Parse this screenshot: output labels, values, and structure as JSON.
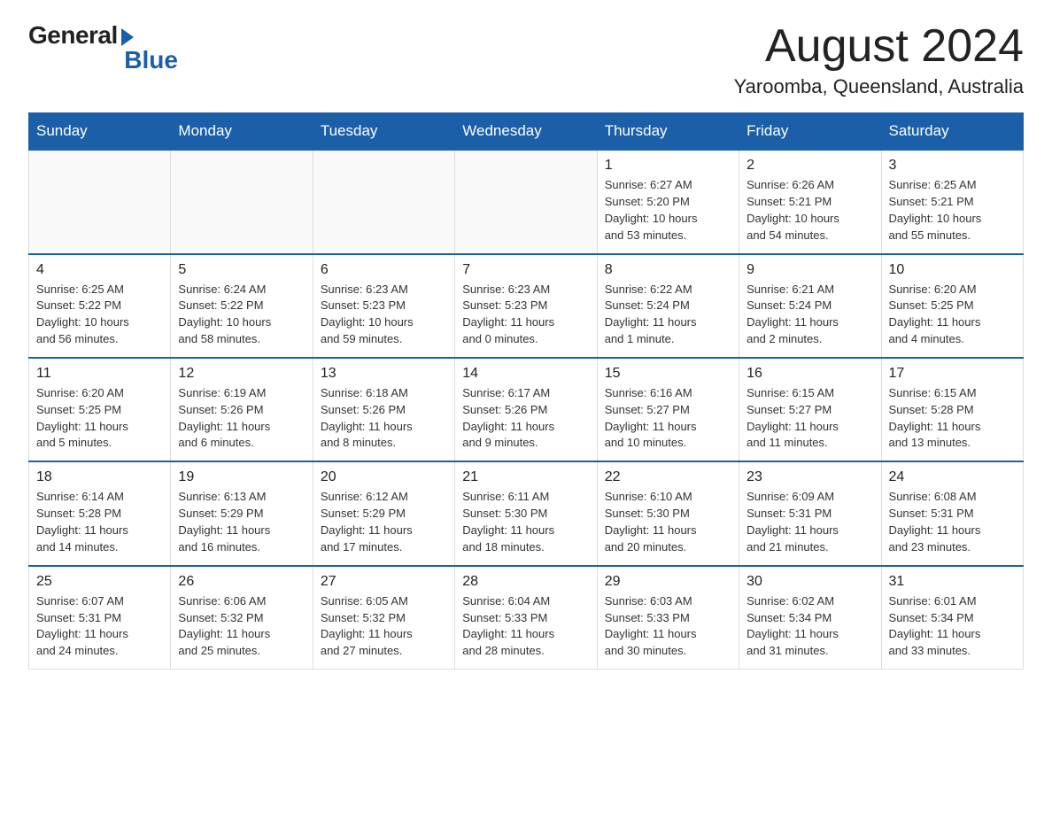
{
  "logo": {
    "general": "General",
    "blue": "Blue"
  },
  "title": "August 2024",
  "location": "Yaroomba, Queensland, Australia",
  "days_of_week": [
    "Sunday",
    "Monday",
    "Tuesday",
    "Wednesday",
    "Thursday",
    "Friday",
    "Saturday"
  ],
  "weeks": [
    [
      {
        "day": "",
        "info": ""
      },
      {
        "day": "",
        "info": ""
      },
      {
        "day": "",
        "info": ""
      },
      {
        "day": "",
        "info": ""
      },
      {
        "day": "1",
        "info": "Sunrise: 6:27 AM\nSunset: 5:20 PM\nDaylight: 10 hours\nand 53 minutes."
      },
      {
        "day": "2",
        "info": "Sunrise: 6:26 AM\nSunset: 5:21 PM\nDaylight: 10 hours\nand 54 minutes."
      },
      {
        "day": "3",
        "info": "Sunrise: 6:25 AM\nSunset: 5:21 PM\nDaylight: 10 hours\nand 55 minutes."
      }
    ],
    [
      {
        "day": "4",
        "info": "Sunrise: 6:25 AM\nSunset: 5:22 PM\nDaylight: 10 hours\nand 56 minutes."
      },
      {
        "day": "5",
        "info": "Sunrise: 6:24 AM\nSunset: 5:22 PM\nDaylight: 10 hours\nand 58 minutes."
      },
      {
        "day": "6",
        "info": "Sunrise: 6:23 AM\nSunset: 5:23 PM\nDaylight: 10 hours\nand 59 minutes."
      },
      {
        "day": "7",
        "info": "Sunrise: 6:23 AM\nSunset: 5:23 PM\nDaylight: 11 hours\nand 0 minutes."
      },
      {
        "day": "8",
        "info": "Sunrise: 6:22 AM\nSunset: 5:24 PM\nDaylight: 11 hours\nand 1 minute."
      },
      {
        "day": "9",
        "info": "Sunrise: 6:21 AM\nSunset: 5:24 PM\nDaylight: 11 hours\nand 2 minutes."
      },
      {
        "day": "10",
        "info": "Sunrise: 6:20 AM\nSunset: 5:25 PM\nDaylight: 11 hours\nand 4 minutes."
      }
    ],
    [
      {
        "day": "11",
        "info": "Sunrise: 6:20 AM\nSunset: 5:25 PM\nDaylight: 11 hours\nand 5 minutes."
      },
      {
        "day": "12",
        "info": "Sunrise: 6:19 AM\nSunset: 5:26 PM\nDaylight: 11 hours\nand 6 minutes."
      },
      {
        "day": "13",
        "info": "Sunrise: 6:18 AM\nSunset: 5:26 PM\nDaylight: 11 hours\nand 8 minutes."
      },
      {
        "day": "14",
        "info": "Sunrise: 6:17 AM\nSunset: 5:26 PM\nDaylight: 11 hours\nand 9 minutes."
      },
      {
        "day": "15",
        "info": "Sunrise: 6:16 AM\nSunset: 5:27 PM\nDaylight: 11 hours\nand 10 minutes."
      },
      {
        "day": "16",
        "info": "Sunrise: 6:15 AM\nSunset: 5:27 PM\nDaylight: 11 hours\nand 11 minutes."
      },
      {
        "day": "17",
        "info": "Sunrise: 6:15 AM\nSunset: 5:28 PM\nDaylight: 11 hours\nand 13 minutes."
      }
    ],
    [
      {
        "day": "18",
        "info": "Sunrise: 6:14 AM\nSunset: 5:28 PM\nDaylight: 11 hours\nand 14 minutes."
      },
      {
        "day": "19",
        "info": "Sunrise: 6:13 AM\nSunset: 5:29 PM\nDaylight: 11 hours\nand 16 minutes."
      },
      {
        "day": "20",
        "info": "Sunrise: 6:12 AM\nSunset: 5:29 PM\nDaylight: 11 hours\nand 17 minutes."
      },
      {
        "day": "21",
        "info": "Sunrise: 6:11 AM\nSunset: 5:30 PM\nDaylight: 11 hours\nand 18 minutes."
      },
      {
        "day": "22",
        "info": "Sunrise: 6:10 AM\nSunset: 5:30 PM\nDaylight: 11 hours\nand 20 minutes."
      },
      {
        "day": "23",
        "info": "Sunrise: 6:09 AM\nSunset: 5:31 PM\nDaylight: 11 hours\nand 21 minutes."
      },
      {
        "day": "24",
        "info": "Sunrise: 6:08 AM\nSunset: 5:31 PM\nDaylight: 11 hours\nand 23 minutes."
      }
    ],
    [
      {
        "day": "25",
        "info": "Sunrise: 6:07 AM\nSunset: 5:31 PM\nDaylight: 11 hours\nand 24 minutes."
      },
      {
        "day": "26",
        "info": "Sunrise: 6:06 AM\nSunset: 5:32 PM\nDaylight: 11 hours\nand 25 minutes."
      },
      {
        "day": "27",
        "info": "Sunrise: 6:05 AM\nSunset: 5:32 PM\nDaylight: 11 hours\nand 27 minutes."
      },
      {
        "day": "28",
        "info": "Sunrise: 6:04 AM\nSunset: 5:33 PM\nDaylight: 11 hours\nand 28 minutes."
      },
      {
        "day": "29",
        "info": "Sunrise: 6:03 AM\nSunset: 5:33 PM\nDaylight: 11 hours\nand 30 minutes."
      },
      {
        "day": "30",
        "info": "Sunrise: 6:02 AM\nSunset: 5:34 PM\nDaylight: 11 hours\nand 31 minutes."
      },
      {
        "day": "31",
        "info": "Sunrise: 6:01 AM\nSunset: 5:34 PM\nDaylight: 11 hours\nand 33 minutes."
      }
    ]
  ]
}
